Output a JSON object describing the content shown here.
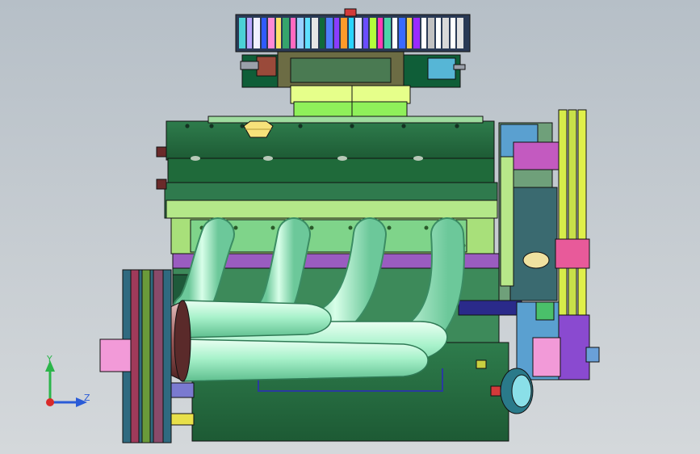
{
  "viewport": {
    "background_top": "#b6bfc7",
    "background_bottom": "#d4d8db"
  },
  "model": {
    "parts": [
      "air-filter",
      "carburetor-base",
      "intake-manifold",
      "valve-cover",
      "oil-filler-cap",
      "cylinder-head",
      "engine-block",
      "exhaust-headers",
      "crank-pulley",
      "timing-cover",
      "accessory-pulleys",
      "water-pump",
      "oil-pan",
      "alternator-bracket"
    ],
    "colors": {
      "air_filter_ring": "#5a8aa0",
      "valve_cover": "#1f6a3a",
      "cylinder_head": "#a8e07a",
      "block_band": "#9a5cc0",
      "block": "#3d8a5a",
      "headers": "#9ff0c0",
      "pulley": "#3a6a8a",
      "cap": "#f3e07a",
      "oil_pan": "#2f7a4d"
    }
  },
  "triad": {
    "y_label": "Y",
    "z_label": "Z",
    "y_color": "#2bb54a",
    "z_color": "#2a5bd7",
    "x_color": "#d92a2a"
  }
}
